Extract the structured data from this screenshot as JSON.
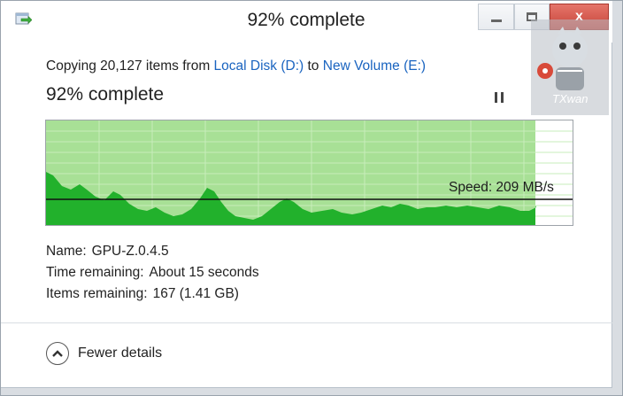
{
  "window": {
    "title": "92% complete",
    "close_label": "x"
  },
  "copy": {
    "prefix": "Copying 20,127 items from",
    "source": "Local Disk (D:)",
    "to_word": "to",
    "destination": "New Volume (E:)",
    "percent_text": "92% complete",
    "progress": 0.92
  },
  "chart": {
    "speed_label": "Speed: 209 MB/s",
    "colors": {
      "done_bg": "#a8e096",
      "remaining_bg": "#ffffff",
      "grid": "#c7edbb",
      "area": "#22b12c",
      "speed_line": "#111111"
    }
  },
  "details": {
    "name_key": "Name:",
    "name_value": "GPU-Z.0.4.5",
    "time_key": "Time remaining:",
    "time_value": "About 15 seconds",
    "items_key": "Items remaining:",
    "items_value": "167 (1.41 GB)"
  },
  "footer": {
    "fewer_details": "Fewer details",
    "fewer_icon": "chevron-up-icon"
  },
  "watermark": {
    "text": "TXwan"
  }
}
